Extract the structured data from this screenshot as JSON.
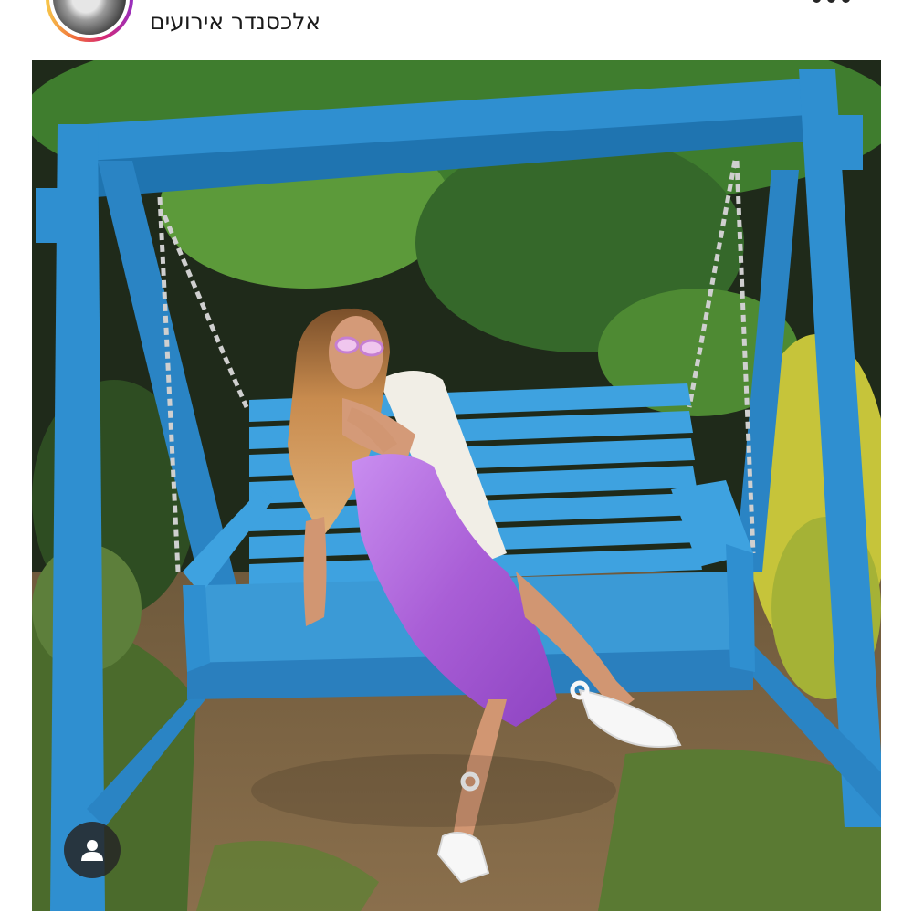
{
  "post": {
    "author": {
      "username": "אלכסנדר אירועים",
      "avatar_icon": "profile-avatar"
    },
    "more_icon": "more-horizontal-icon",
    "image": {
      "alt": "",
      "tag_icon": "person-tag-icon"
    }
  },
  "colors": {
    "swing_blue": "#2f8fd0",
    "dress_purple": "#b06ad8",
    "foliage_green": "#3f7d2e"
  }
}
